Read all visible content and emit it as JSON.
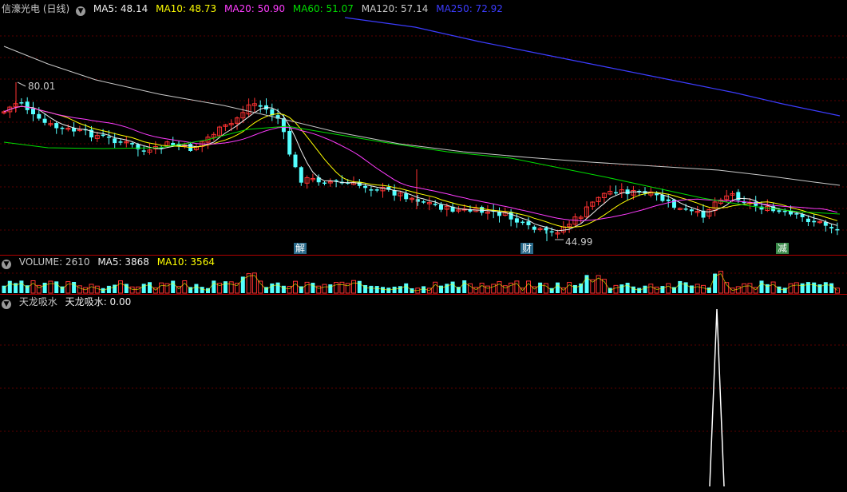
{
  "main": {
    "title": "信濠光电 (日线)",
    "ma": [
      {
        "label": "MA5: 48.14",
        "color": "#f0f0f0"
      },
      {
        "label": "MA10: 48.73",
        "color": "#ffff00"
      },
      {
        "label": "MA20: 50.90",
        "color": "#ff3cff"
      },
      {
        "label": "MA60: 51.07",
        "color": "#00dd00"
      },
      {
        "label": "MA120: 57.14",
        "color": "#c8c8c8"
      },
      {
        "label": "MA250: 72.92",
        "color": "#3c3cff"
      }
    ],
    "high_label": "80.01",
    "low_label": "44.99",
    "markers": [
      {
        "text": "解"
      },
      {
        "text": "财"
      },
      {
        "text": "减"
      }
    ]
  },
  "volume": {
    "label": "VOLUME: 2610",
    "ma5": "MA5: 3868",
    "ma10": "MA10: 3564"
  },
  "indicator": {
    "name": "天龙吸水",
    "value": "天龙吸水: 0.00"
  },
  "colors": {
    "up": "#ff3232",
    "down": "#54ffff",
    "grid": "#5a0000",
    "sep": "#b00000"
  }
}
